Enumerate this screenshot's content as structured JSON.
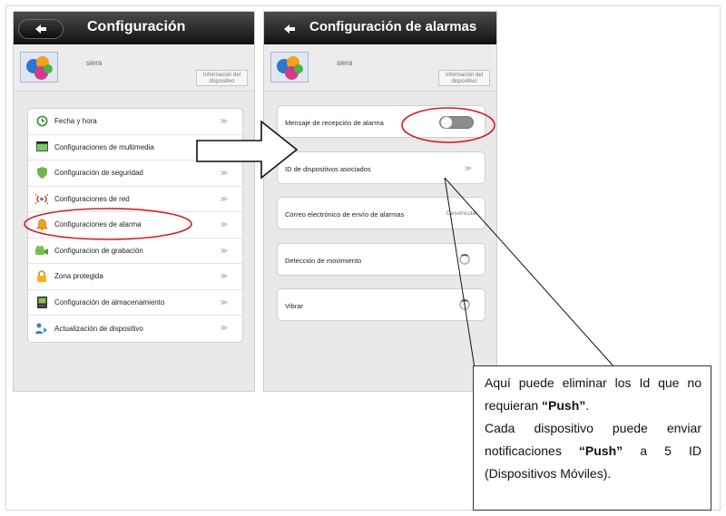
{
  "left_screen": {
    "title": "Configuración",
    "username": "siera",
    "info_button": "Información del dispositivo",
    "menu": [
      {
        "label": "Fecha y hora",
        "icon": "clock-icon",
        "chevron": "≫"
      },
      {
        "label": "Configuraciones de multimedia",
        "icon": "video-icon",
        "chevron": ""
      },
      {
        "label": "Configuración de seguridad",
        "icon": "shield-icon",
        "chevron": "≫"
      },
      {
        "label": "Configuraciones de red",
        "icon": "wifi-icon",
        "chevron": "≫"
      },
      {
        "label": "Configuraciones de alarma",
        "icon": "bell-icon",
        "chevron": "≫"
      },
      {
        "label": "Configuracion de grabación",
        "icon": "camera-icon",
        "chevron": "≫"
      },
      {
        "label": "Zona protegida",
        "icon": "lock-icon",
        "chevron": "≫"
      },
      {
        "label": "Configuración de almacenamiento",
        "icon": "storage-icon",
        "chevron": "≫"
      },
      {
        "label": "Actualización de dispositivo",
        "icon": "update-icon",
        "chevron": "≫"
      }
    ]
  },
  "right_screen": {
    "title": "Configuración de alarmas",
    "username": "siera",
    "info_button": "Información del dispositivo",
    "items": [
      {
        "label": "Mensaje de recepción de alarma",
        "control": "toggle"
      },
      {
        "label": "ID de dispositivos asociados",
        "control": "chevron",
        "chevron": "≫"
      },
      {
        "label": "Correo electrónico de envío de alarmas",
        "control": "text",
        "side_text": "Desvincular"
      },
      {
        "label": "Detección de movimiento",
        "control": "spinner"
      },
      {
        "label": "Vibrar",
        "control": "spinner"
      }
    ]
  },
  "callout": {
    "p1_a": "Aquí puede eliminar los Id que no requieran ",
    "p1_b": "“Push”",
    "p1_c": ".",
    "p2_a": "Cada dispositivo puede enviar notificaciones ",
    "p2_b": "“Push”",
    "p2_c": " a 5 ID (Dispositivos Móviles)."
  },
  "colors": {
    "highlight_ellipse": "#d81e2a",
    "titlebar": "#1a1a1a",
    "panel_bg": "#e9e9e9"
  }
}
